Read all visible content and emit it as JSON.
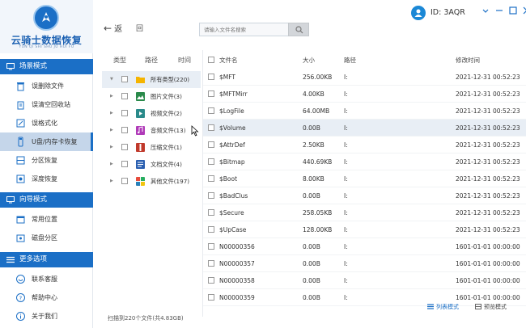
{
  "app": {
    "logo_title": "云骑士数据恢复",
    "logo_sub": "YUN QI SHI SHU JU HUI FU"
  },
  "sidebar": {
    "sections": [
      {
        "label": "场景模式",
        "items": [
          "误删除文件",
          "误清空回收站",
          "误格式化",
          "U盘/内存卡恢复",
          "分区恢复",
          "深度恢复"
        ]
      },
      {
        "label": "向导模式",
        "items": [
          "常用位置",
          "磁盘分区"
        ]
      },
      {
        "label": "更多选项",
        "items": [
          "联系客服",
          "帮助中心",
          "关于我们"
        ]
      }
    ],
    "active_item": "U盘/内存卡恢复"
  },
  "toolbar": {
    "back_label": "返",
    "refresh_label": "回",
    "search_placeholder": "请输入文件名搜索"
  },
  "account": {
    "id_text": "ID: 3AQR"
  },
  "tree": {
    "headers": [
      "类型",
      "路径",
      "时间"
    ],
    "items": [
      {
        "label": "所有类型(220)",
        "icon": "folder-icon",
        "color": "#f5b400"
      },
      {
        "label": "图片文件(3)",
        "icon": "image-file-icon",
        "color": "#2a8a4a"
      },
      {
        "label": "视频文件(2)",
        "icon": "video-file-icon",
        "color": "#2a8a8a"
      },
      {
        "label": "音频文件(13)",
        "icon": "audio-file-icon",
        "color": "#b03ab8"
      },
      {
        "label": "压缩文件(1)",
        "icon": "archive-file-icon",
        "color": "#c0392b"
      },
      {
        "label": "文档文件(4)",
        "icon": "document-file-icon",
        "color": "#2a5fb0"
      },
      {
        "label": "其他文件(197)",
        "icon": "other-file-icon",
        "color": "#e67e22"
      }
    ]
  },
  "table": {
    "headers": {
      "name": "文件名",
      "size": "大小",
      "path": "路径",
      "time": "修改时间"
    },
    "rows": [
      {
        "name": "$MFT",
        "size": "256.00KB",
        "path": "I:",
        "time": "2021-12-31 00:52:23"
      },
      {
        "name": "$MFTMirr",
        "size": "4.00KB",
        "path": "I:",
        "time": "2021-12-31 00:52:23"
      },
      {
        "name": "$LogFile",
        "size": "64.00MB",
        "path": "I:",
        "time": "2021-12-31 00:52:23"
      },
      {
        "name": "$Volume",
        "size": "0.00B",
        "path": "I:",
        "time": "2021-12-31 00:52:23"
      },
      {
        "name": "$AttrDef",
        "size": "2.50KB",
        "path": "I:",
        "time": "2021-12-31 00:52:23"
      },
      {
        "name": "$Bitmap",
        "size": "440.69KB",
        "path": "I:",
        "time": "2021-12-31 00:52:23"
      },
      {
        "name": "$Boot",
        "size": "8.00KB",
        "path": "I:",
        "time": "2021-12-31 00:52:23"
      },
      {
        "name": "$BadClus",
        "size": "0.00B",
        "path": "I:",
        "time": "2021-12-31 00:52:23"
      },
      {
        "name": "$Secure",
        "size": "258.05KB",
        "path": "I:",
        "time": "2021-12-31 00:52:23"
      },
      {
        "name": "$UpCase",
        "size": "128.00KB",
        "path": "I:",
        "time": "2021-12-31 00:52:23"
      },
      {
        "name": "N00000356",
        "size": "0.00B",
        "path": "I:",
        "time": "1601-01-01 00:00:00"
      },
      {
        "name": "N00000357",
        "size": "0.00B",
        "path": "I:",
        "time": "1601-01-01 00:00:00"
      },
      {
        "name": "N00000358",
        "size": "0.00B",
        "path": "I:",
        "time": "1601-01-01 00:00:00"
      },
      {
        "name": "N00000359",
        "size": "0.00B",
        "path": "I:",
        "time": "1601-01-01 00:00:00"
      }
    ]
  },
  "status": {
    "scan_text": "扫描到220个文件(共4.83GB)",
    "list_mode": "列表模式",
    "preview_mode": "预览模式"
  },
  "colors": {
    "accent": "#1b6fc6",
    "active_bg": "#c5d6ea"
  }
}
